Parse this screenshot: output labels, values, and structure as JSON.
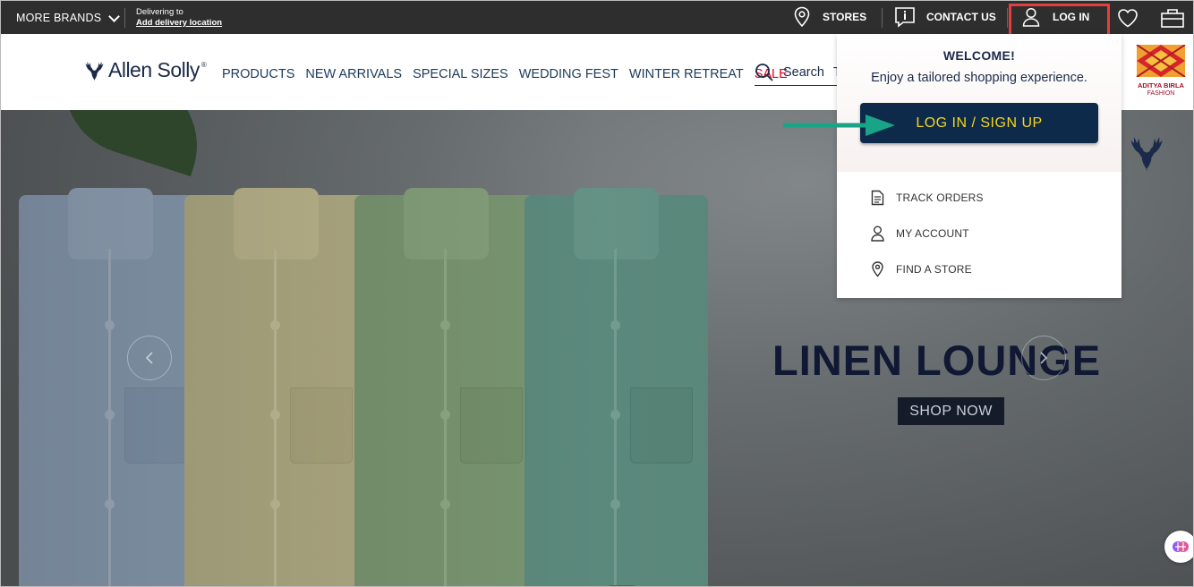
{
  "topbar": {
    "more_brands": "MORE BRANDS",
    "delivering_to": "Delivering to",
    "add_location": "Add delivery location",
    "stores": "STORES",
    "contact_us": "CONTACT US",
    "log_in": "LOG IN"
  },
  "nav": {
    "logo_text": "Allen Solly",
    "items": [
      "PRODUCTS",
      "NEW ARRIVALS",
      "SPECIAL SIZES",
      "WEDDING FEST",
      "WINTER RETREAT",
      "SALE"
    ],
    "search_placeholder": "Search",
    "search_trailing": "T",
    "partner_logo_line1": "ADITYA BIRLA",
    "partner_logo_line2": "FASHION"
  },
  "hero": {
    "title": "LINEN LOUNGE",
    "cta": "SHOP NOW"
  },
  "dropdown": {
    "welcome": "WELCOME!",
    "subtitle": "Enjoy a tailored shopping experience.",
    "button": "LOG IN / SIGN UP",
    "items": [
      {
        "label": "TRACK ORDERS",
        "icon": "document-icon"
      },
      {
        "label": "MY ACCOUNT",
        "icon": "user-icon"
      },
      {
        "label": "FIND A STORE",
        "icon": "location-pin-icon"
      }
    ]
  },
  "colors": {
    "topbar_bg": "#2e2e2e",
    "brand_navy": "#0d2a4a",
    "button_text": "#f5d61e",
    "sale_red": "#e0001b",
    "highlight_box": "#e53e3e",
    "annotation_arrow": "#1aa487"
  }
}
